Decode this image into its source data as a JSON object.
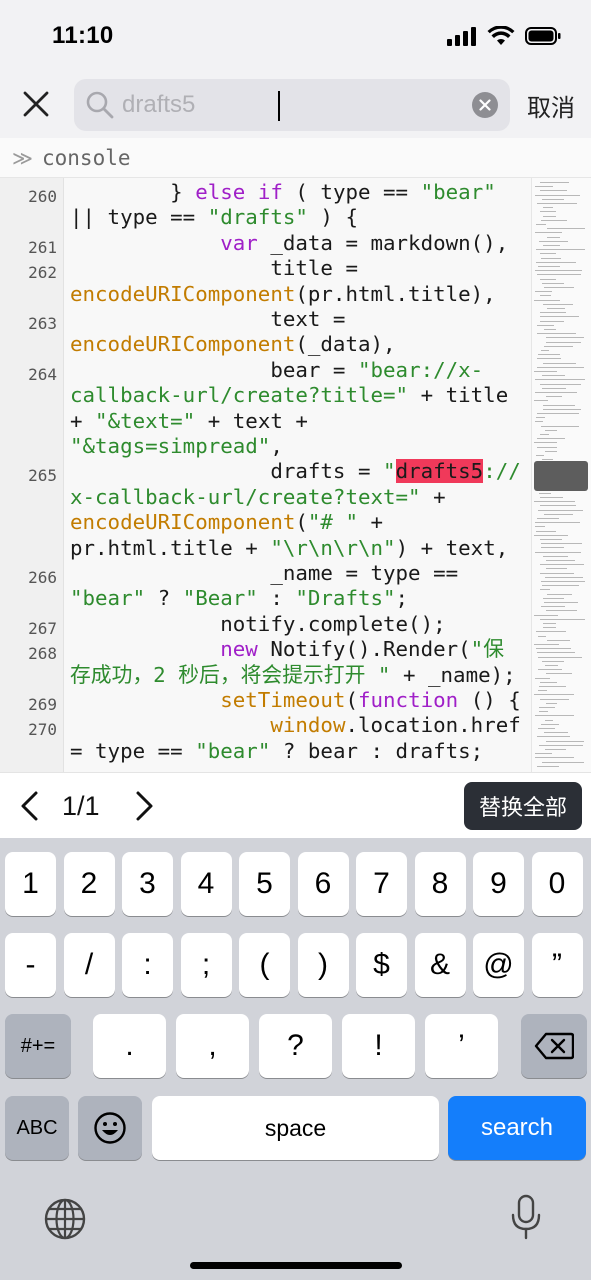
{
  "status_bar": {
    "time": "11:10"
  },
  "search": {
    "query": "drafts5",
    "cancel_label": "取消"
  },
  "console": {
    "prompt": "≫",
    "label": "console"
  },
  "code": {
    "lines": [
      {
        "no": "260",
        "segments": [
          [
            "p",
            "        } "
          ],
          [
            "kw",
            "else if"
          ],
          [
            "p",
            " ( type == "
          ],
          [
            "str",
            "\"bear\""
          ]
        ]
      },
      {
        "no": "",
        "segments": [
          [
            "p",
            "|| type == "
          ],
          [
            "str",
            "\"drafts\""
          ],
          [
            "p",
            " ) {"
          ]
        ]
      },
      {
        "no": "261",
        "segments": [
          [
            "p",
            "            "
          ],
          [
            "kw",
            "var"
          ],
          [
            "p",
            " _data = markdown(),"
          ]
        ]
      },
      {
        "no": "262",
        "segments": [
          [
            "p",
            "                title ="
          ]
        ]
      },
      {
        "no": "",
        "segments": [
          [
            "fn",
            "encodeURIComponent"
          ],
          [
            "p",
            "(pr.html.title),"
          ]
        ]
      },
      {
        "no": "263",
        "segments": [
          [
            "p",
            "                text ="
          ]
        ]
      },
      {
        "no": "",
        "segments": [
          [
            "fn",
            "encodeURIComponent"
          ],
          [
            "p",
            "(_data),"
          ]
        ]
      },
      {
        "no": "264",
        "segments": [
          [
            "p",
            "                bear = "
          ],
          [
            "str",
            "\"bear://x-"
          ]
        ]
      },
      {
        "no": "",
        "segments": [
          [
            "str",
            "callback-url/create?title=\""
          ],
          [
            "p",
            " + title"
          ]
        ]
      },
      {
        "no": "",
        "segments": [
          [
            "p",
            "+ "
          ],
          [
            "str",
            "\"&text=\""
          ],
          [
            "p",
            " + text +"
          ]
        ]
      },
      {
        "no": "",
        "segments": [
          [
            "str",
            "\"&tags=simpread\""
          ],
          [
            "p",
            ","
          ]
        ]
      },
      {
        "no": "265",
        "segments": [
          [
            "p",
            "                drafts = "
          ],
          [
            "str",
            "\""
          ],
          [
            "hl",
            "drafts5"
          ],
          [
            "str",
            "://"
          ]
        ]
      },
      {
        "no": "",
        "segments": [
          [
            "str",
            "x-callback-url/create?text=\""
          ],
          [
            "p",
            " +"
          ]
        ]
      },
      {
        "no": "",
        "segments": [
          [
            "fn",
            "encodeURIComponent"
          ],
          [
            "p",
            "("
          ],
          [
            "str",
            "\"# \""
          ],
          [
            "p",
            " +"
          ]
        ]
      },
      {
        "no": "",
        "segments": [
          [
            "p",
            "pr.html.title + "
          ],
          [
            "str",
            "\"\\r\\n\\r\\n\""
          ],
          [
            "p",
            ") + text,"
          ]
        ]
      },
      {
        "no": "266",
        "segments": [
          [
            "p",
            "                _name = type =="
          ]
        ]
      },
      {
        "no": "",
        "segments": [
          [
            "str",
            "\"bear\""
          ],
          [
            "p",
            " ? "
          ],
          [
            "str",
            "\"Bear\""
          ],
          [
            "p",
            " : "
          ],
          [
            "str",
            "\"Drafts\""
          ],
          [
            "p",
            ";"
          ]
        ]
      },
      {
        "no": "267",
        "segments": [
          [
            "p",
            "            notify.complete();"
          ]
        ]
      },
      {
        "no": "268",
        "segments": [
          [
            "p",
            "            "
          ],
          [
            "kw",
            "new"
          ],
          [
            "p",
            " Notify().Render("
          ],
          [
            "str",
            "\"保"
          ]
        ]
      },
      {
        "no": "",
        "segments": [
          [
            "str",
            "存成功，2 秒后，将会提示打开 \""
          ],
          [
            "p",
            " + _name);"
          ]
        ]
      },
      {
        "no": "269",
        "segments": [
          [
            "p",
            "            "
          ],
          [
            "fn",
            "setTimeout"
          ],
          [
            "p",
            "("
          ],
          [
            "kw",
            "function"
          ],
          [
            "p",
            " () {"
          ]
        ]
      },
      {
        "no": "270",
        "segments": [
          [
            "p",
            "                "
          ],
          [
            "fn",
            "window"
          ],
          [
            "p",
            ".location.href"
          ]
        ]
      },
      {
        "no": "",
        "segments": [
          [
            "p",
            "= type == "
          ],
          [
            "str",
            "\"bear\""
          ],
          [
            "p",
            " ? bear : drafts;"
          ]
        ]
      }
    ]
  },
  "find_bar": {
    "match_count": "1/1",
    "replace_all_label": "替换全部"
  },
  "keyboard": {
    "row1": [
      "1",
      "2",
      "3",
      "4",
      "5",
      "6",
      "7",
      "8",
      "9",
      "0"
    ],
    "row2": [
      "-",
      "/",
      ":",
      ";",
      "(",
      ")",
      "$",
      "&",
      "@",
      "”"
    ],
    "row3": [
      ".",
      ",",
      "?",
      "!",
      "’"
    ],
    "symbols_label": "#+=",
    "abc_label": "ABC",
    "space_label": "space",
    "search_label": "search"
  }
}
